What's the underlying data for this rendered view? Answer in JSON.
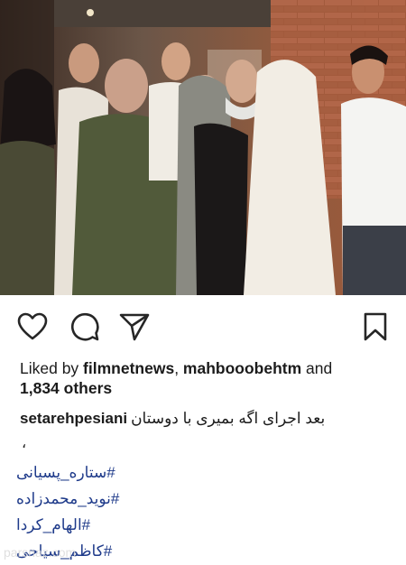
{
  "post": {
    "photo_alt": "",
    "likes": {
      "prefix": "Liked by ",
      "user1": "filmnetnews",
      "separator": ", ",
      "user2": "mahbooobehtm",
      "and": " and",
      "count_text": "1,834 others"
    },
    "caption": {
      "username": "setarehpesiani",
      "text": "بعد اجرای اگه بمیری با دوستان"
    },
    "comma": "،",
    "hashtags": [
      "#ستاره_پسیانی",
      "#نوید_محمدزاده",
      "#الهام_کردا",
      "#کاظم_سیاحی"
    ],
    "watermark": "parsnaz.com"
  },
  "icons": {
    "like": "heart-icon",
    "comment": "comment-icon",
    "share": "send-icon",
    "save": "bookmark-icon"
  },
  "colors": {
    "hashtag": "#1e3a8a",
    "text": "#1b1b1b"
  }
}
